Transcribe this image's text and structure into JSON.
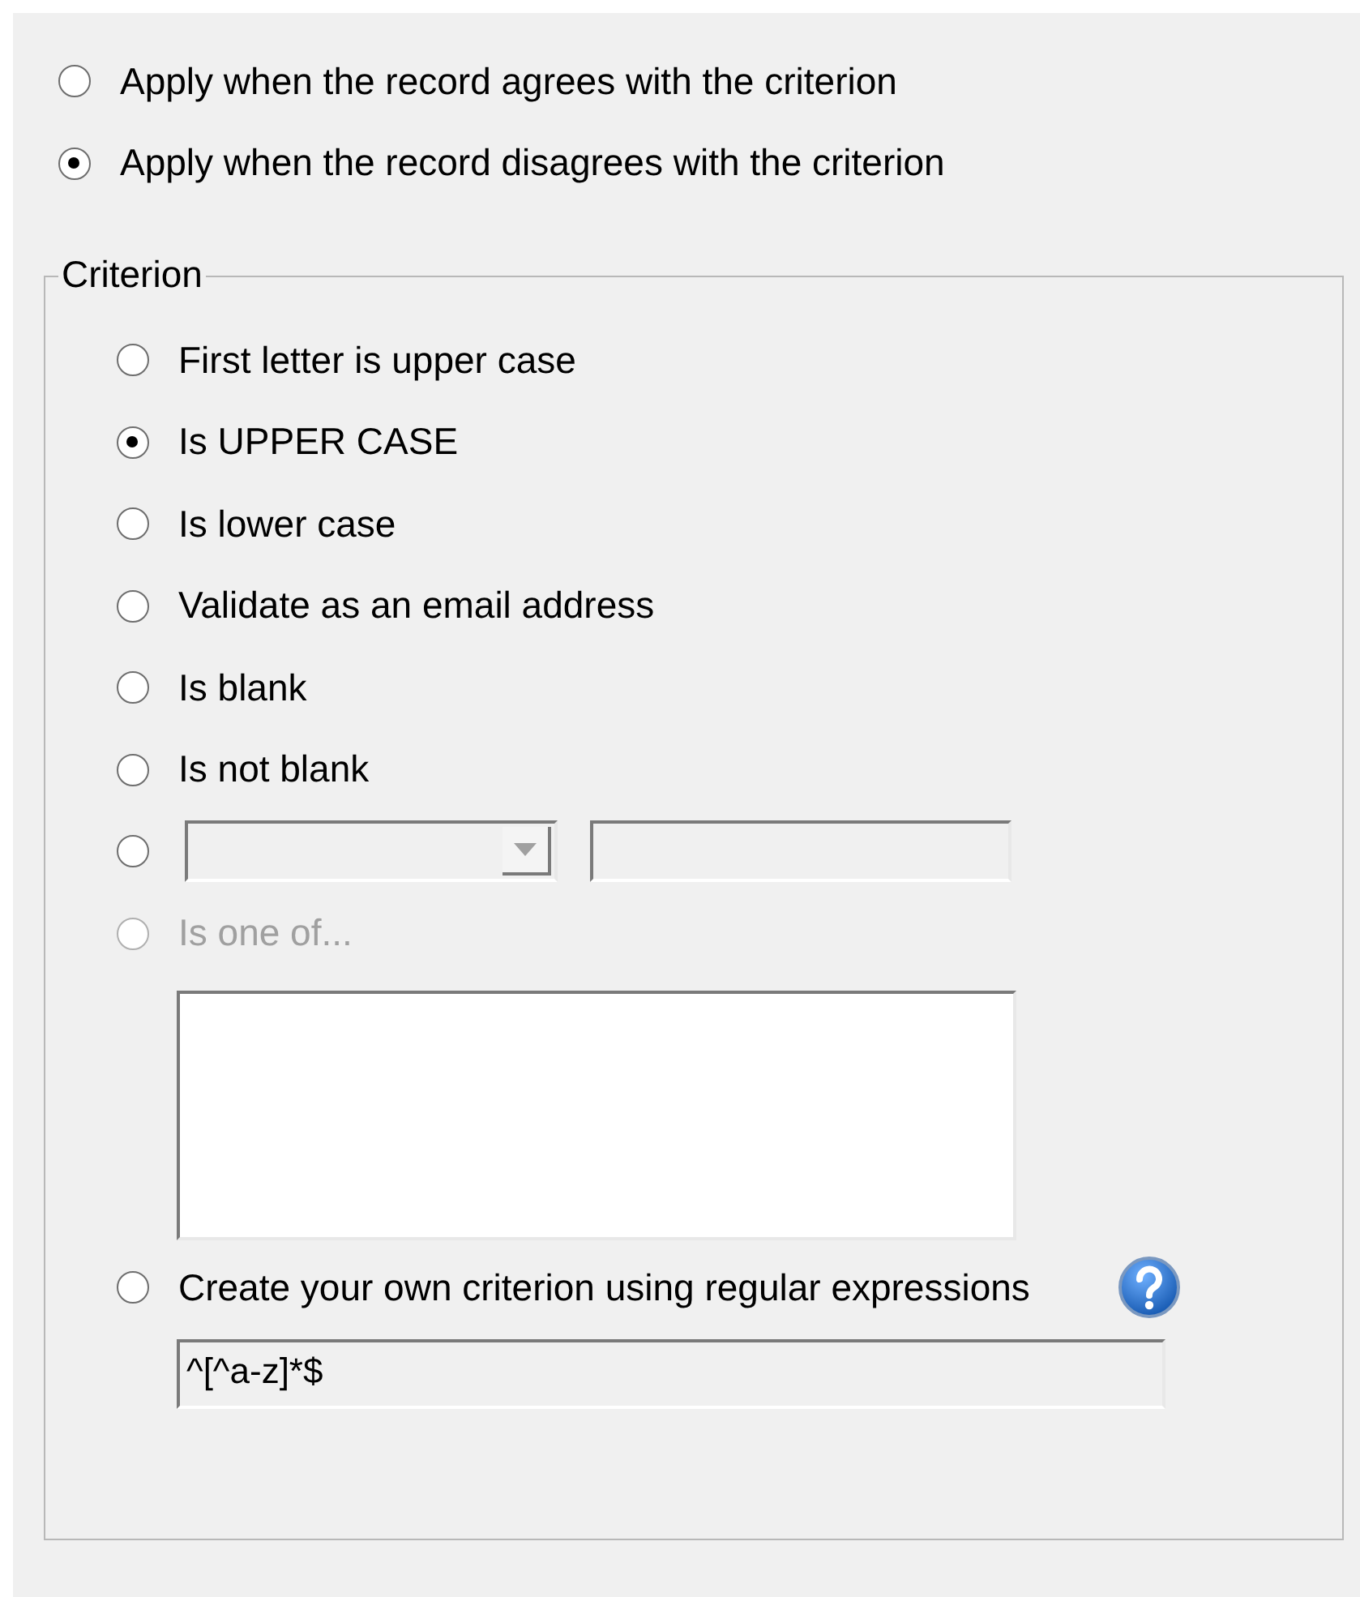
{
  "apply_mode": [
    {
      "label": "Apply when the record agrees with the criterion",
      "selected": false
    },
    {
      "label": "Apply when the record disagrees with the criterion",
      "selected": true
    }
  ],
  "criterion": {
    "title": "Criterion",
    "options": [
      {
        "kind": "simple",
        "label": "First letter is upper case",
        "selected": false,
        "disabled": false
      },
      {
        "kind": "simple",
        "label": "Is UPPER CASE",
        "selected": true,
        "disabled": false
      },
      {
        "kind": "simple",
        "label": "Is lower case",
        "selected": false,
        "disabled": false
      },
      {
        "kind": "simple",
        "label": "Validate as an email address",
        "selected": false,
        "disabled": false
      },
      {
        "kind": "simple",
        "label": "Is blank",
        "selected": false,
        "disabled": false
      },
      {
        "kind": "simple",
        "label": "Is not blank",
        "selected": false,
        "disabled": false
      },
      {
        "kind": "condition",
        "selected": false,
        "disabled": false
      },
      {
        "kind": "list",
        "label": "Is one of...",
        "selected": false,
        "disabled": true
      },
      {
        "kind": "regex",
        "label": "Create your own criterion using regular expressions",
        "selected": false,
        "disabled": false,
        "value": "^[^a-z]*$"
      }
    ]
  }
}
